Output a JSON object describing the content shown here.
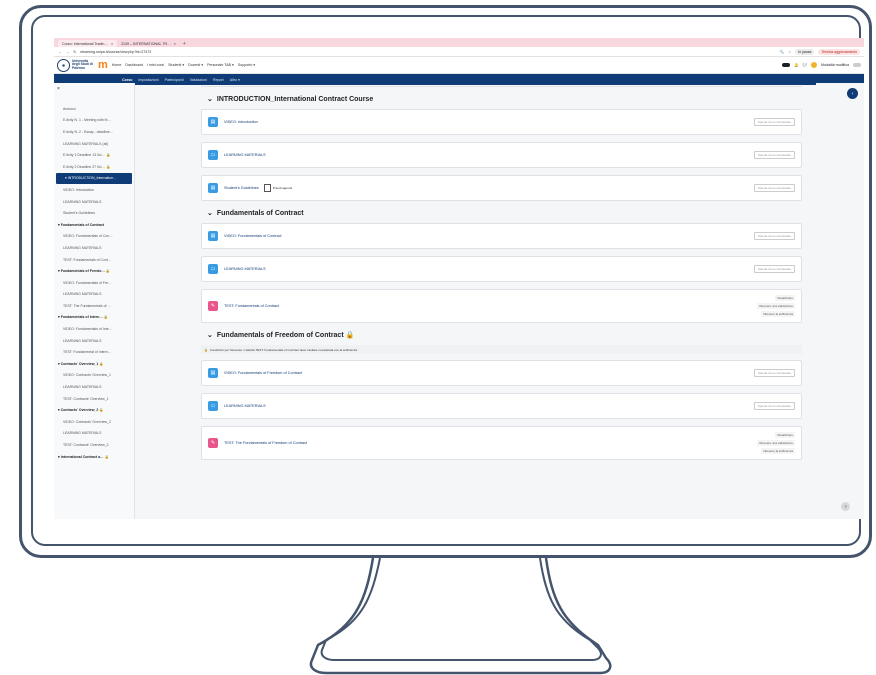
{
  "browser": {
    "tabs": [
      {
        "label": "Corso: International Tradin…",
        "close": "×"
      },
      {
        "label": "2139 – INTERNATIONAL TR…",
        "close": "×"
      }
    ],
    "new_tab": "+",
    "url": "elearning.unipa.it/course/view.php?id=27472",
    "status_pill": "In pausa",
    "update_pill": "Termina aggiornamento"
  },
  "topnav": {
    "logo_text": "Università degli Studi di Palermo",
    "moodle_logo": "m",
    "links": [
      "Home",
      "Dashboard",
      "I miei corsi",
      "Studenti ▾",
      "Docenti ▾",
      "Personale TAB ▾",
      "Supporto ▾"
    ],
    "mode_label": "Modalità modifica"
  },
  "secnav": {
    "items": [
      "Corso",
      "Impostazioni",
      "Partecipanti",
      "Valutazioni",
      "Report",
      "Altro ▾"
    ]
  },
  "drawer": {
    "close": "×",
    "items": [
      {
        "label": "Annunci",
        "type": "item"
      },
      {
        "label": "E-tivity N. 1 - Meeting with th…",
        "type": "item"
      },
      {
        "label": "E-tivity N. 2 - Essay - deadline…",
        "type": "item"
      },
      {
        "label": "LEARNING MATERIALS (all)",
        "type": "item"
      },
      {
        "label": "E-tivity 1 Deadline 13 No… 🔒",
        "type": "item"
      },
      {
        "label": "E-tivity 2 Deadline 27 No… 🔒",
        "type": "item"
      },
      {
        "label": "▾ INTRODUCTION_Internation…",
        "type": "active"
      },
      {
        "label": "VIDEO: Introduction",
        "type": "item"
      },
      {
        "label": "LEARNING MATERIALS",
        "type": "item"
      },
      {
        "label": "Student's Guidelines",
        "type": "item"
      },
      {
        "label": "▾ Fundamentals of Contract",
        "type": "section"
      },
      {
        "label": "VIDEO: Fundamentals of Con…",
        "type": "item"
      },
      {
        "label": "LEARNING MATERIALS",
        "type": "item"
      },
      {
        "label": "TEST: Fundamentals of Cont…",
        "type": "item"
      },
      {
        "label": "▾ Fundamentals of Freedo… 🔒",
        "type": "section"
      },
      {
        "label": "VIDEO: Fundamentals of Fre…",
        "type": "item"
      },
      {
        "label": "LEARNING MATERIALS",
        "type": "item"
      },
      {
        "label": "TEST: The Fundamentals of …",
        "type": "item"
      },
      {
        "label": "▾ Fundamentals of Intern… 🔒",
        "type": "section"
      },
      {
        "label": "VIDEO: Fundamentals of Inte…",
        "type": "item"
      },
      {
        "label": "LEARNING MATERIALS",
        "type": "item"
      },
      {
        "label": "TEST: Fundamental of Intern…",
        "type": "item"
      },
      {
        "label": "▾ Contracts' Overview_1 🔒",
        "type": "section"
      },
      {
        "label": "VIDEO: Contracts' Overview_1",
        "type": "item"
      },
      {
        "label": "LEARNING MATERIALS",
        "type": "item"
      },
      {
        "label": "TEST: Contracts' Overview_1",
        "type": "item"
      },
      {
        "label": "▾ Contracts' Overview_2 🔒",
        "type": "section"
      },
      {
        "label": "VIDEO: Contracts' Overview_2",
        "type": "item"
      },
      {
        "label": "LEARNING MATERIALS",
        "type": "item"
      },
      {
        "label": "TEST: Contracts' Overview_2",
        "type": "item"
      },
      {
        "label": "▾ International Contract a… 🔒",
        "type": "section"
      }
    ]
  },
  "sections": [
    {
      "title": "INTRODUCTION_International Contract Course",
      "activities": [
        {
          "icon": "page",
          "name": "VIDEO: Introduction",
          "status": "Spunta come completato"
        },
        {
          "icon": "folder",
          "name": "LEARNING MATERIALS",
          "status": "Spunta come completato"
        },
        {
          "icon": "page",
          "name": "Student's Guidelines",
          "status": "Spunta come completato",
          "pdf": "Prendi appunti"
        }
      ]
    },
    {
      "title": "Fundamentals of Contract",
      "activities": [
        {
          "icon": "page",
          "name": "VIDEO: Fundamentals of Contract",
          "status": "Spunta come completato"
        },
        {
          "icon": "folder",
          "name": "LEARNING MATERIALS",
          "status": "Spunta come completato"
        },
        {
          "icon": "quiz",
          "name": "TEST: Fundamentals of Contract",
          "multi": [
            "Visualizzare",
            "Ricevere una valutazione",
            "Ottenere la sufficienza"
          ]
        }
      ]
    },
    {
      "title": "Fundamentals of Freedom of Contract 🔒",
      "restriction": "Condizioni per l'accesso: L'attività TEST: Fundamentals of Contract deve risultare completata con la sufficienza",
      "activities": [
        {
          "icon": "page",
          "name": "VIDEO: Fundamentals of Freedom of Contract",
          "status": "Spunta come completato"
        },
        {
          "icon": "folder",
          "name": "LEARNING MATERIALS",
          "status": "Spunta come completato"
        },
        {
          "icon": "quiz",
          "name": "TEST: The Fundamentals of Freedom of Contract",
          "multi": [
            "Visualizzare",
            "Ricevere una valutazione",
            "Ottenere la sufficienza"
          ]
        }
      ]
    }
  ],
  "help": "?"
}
